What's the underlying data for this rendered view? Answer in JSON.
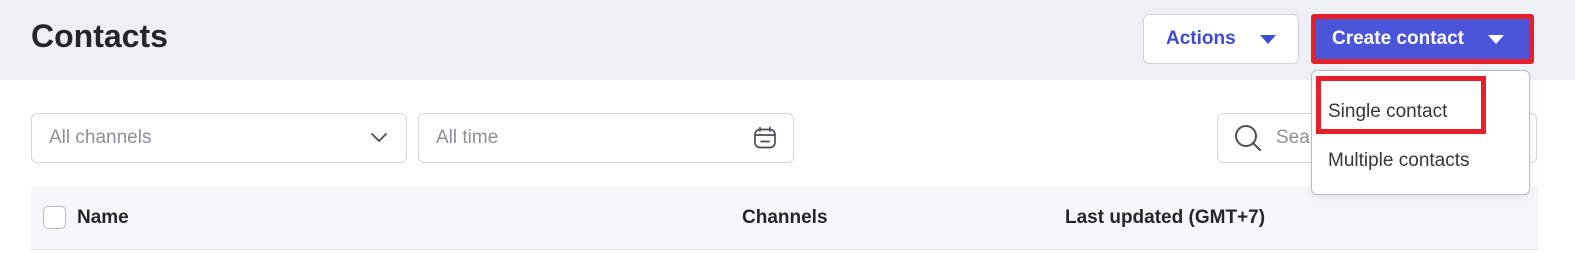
{
  "page": {
    "title": "Contacts"
  },
  "header": {
    "actions_label": "Actions",
    "create_label": "Create contact"
  },
  "create_menu": {
    "items": [
      {
        "label": "Single contact"
      },
      {
        "label": "Multiple contacts"
      }
    ]
  },
  "filters": {
    "channels": {
      "selected": "All channels"
    },
    "date": {
      "placeholder": "All time"
    },
    "search": {
      "placeholder": "Search"
    }
  },
  "table": {
    "columns": [
      "Name",
      "Channels",
      "Last updated (GMT+7)"
    ]
  },
  "colors": {
    "accent": "#4b55d9",
    "highlight": "#e5202a",
    "header_bg": "#eef0f6"
  },
  "icons": [
    "chevron-down-icon",
    "calendar-icon",
    "search-icon",
    "caret-down-icon"
  ]
}
